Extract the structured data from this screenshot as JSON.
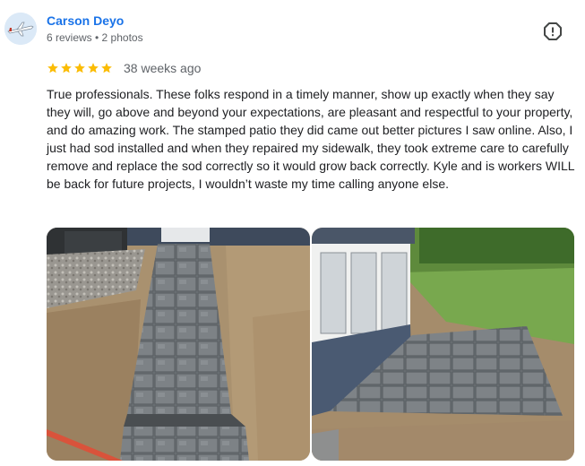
{
  "reviewer": {
    "name": "Carson Deyo",
    "meta": "6 reviews • 2 photos",
    "avatar_icon": "airplane-icon"
  },
  "rating": {
    "stars": 5,
    "max_stars": 5,
    "star_color": "#fbbc04",
    "date": "38 weeks ago"
  },
  "review": {
    "text": "True professionals. These folks respond in a timely manner, show up exactly when they say they will, go above and beyond your expectations, are pleasant and respectful to your property, and do amazing work. The stamped patio they did came out better pictures I saw online. Also, I just had sod installed and when they repaired my sidewalk, they took extreme care to carefully remove and replace the sod correctly so it would grow back correctly. Kyle and is workers WILL be back for future projects, I wouldn’t waste my time calling anyone else."
  },
  "actions": {
    "report_icon": "report-icon"
  },
  "photos": [
    {
      "subject": "stamped-walkway-photo"
    },
    {
      "subject": "stamped-patio-photo"
    }
  ],
  "colors": {
    "name_link": "#1a73e8",
    "secondary_text": "#5f6368"
  }
}
